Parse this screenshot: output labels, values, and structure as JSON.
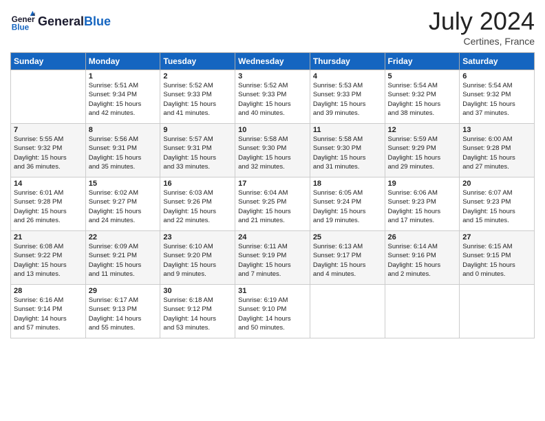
{
  "header": {
    "logo_line1": "General",
    "logo_line2": "Blue",
    "month_year": "July 2024",
    "location": "Certines, France"
  },
  "weekdays": [
    "Sunday",
    "Monday",
    "Tuesday",
    "Wednesday",
    "Thursday",
    "Friday",
    "Saturday"
  ],
  "weeks": [
    [
      {
        "day": "",
        "text": ""
      },
      {
        "day": "1",
        "text": "Sunrise: 5:51 AM\nSunset: 9:34 PM\nDaylight: 15 hours\nand 42 minutes."
      },
      {
        "day": "2",
        "text": "Sunrise: 5:52 AM\nSunset: 9:33 PM\nDaylight: 15 hours\nand 41 minutes."
      },
      {
        "day": "3",
        "text": "Sunrise: 5:52 AM\nSunset: 9:33 PM\nDaylight: 15 hours\nand 40 minutes."
      },
      {
        "day": "4",
        "text": "Sunrise: 5:53 AM\nSunset: 9:33 PM\nDaylight: 15 hours\nand 39 minutes."
      },
      {
        "day": "5",
        "text": "Sunrise: 5:54 AM\nSunset: 9:32 PM\nDaylight: 15 hours\nand 38 minutes."
      },
      {
        "day": "6",
        "text": "Sunrise: 5:54 AM\nSunset: 9:32 PM\nDaylight: 15 hours\nand 37 minutes."
      }
    ],
    [
      {
        "day": "7",
        "text": "Sunrise: 5:55 AM\nSunset: 9:32 PM\nDaylight: 15 hours\nand 36 minutes."
      },
      {
        "day": "8",
        "text": "Sunrise: 5:56 AM\nSunset: 9:31 PM\nDaylight: 15 hours\nand 35 minutes."
      },
      {
        "day": "9",
        "text": "Sunrise: 5:57 AM\nSunset: 9:31 PM\nDaylight: 15 hours\nand 33 minutes."
      },
      {
        "day": "10",
        "text": "Sunrise: 5:58 AM\nSunset: 9:30 PM\nDaylight: 15 hours\nand 32 minutes."
      },
      {
        "day": "11",
        "text": "Sunrise: 5:58 AM\nSunset: 9:30 PM\nDaylight: 15 hours\nand 31 minutes."
      },
      {
        "day": "12",
        "text": "Sunrise: 5:59 AM\nSunset: 9:29 PM\nDaylight: 15 hours\nand 29 minutes."
      },
      {
        "day": "13",
        "text": "Sunrise: 6:00 AM\nSunset: 9:28 PM\nDaylight: 15 hours\nand 27 minutes."
      }
    ],
    [
      {
        "day": "14",
        "text": "Sunrise: 6:01 AM\nSunset: 9:28 PM\nDaylight: 15 hours\nand 26 minutes."
      },
      {
        "day": "15",
        "text": "Sunrise: 6:02 AM\nSunset: 9:27 PM\nDaylight: 15 hours\nand 24 minutes."
      },
      {
        "day": "16",
        "text": "Sunrise: 6:03 AM\nSunset: 9:26 PM\nDaylight: 15 hours\nand 22 minutes."
      },
      {
        "day": "17",
        "text": "Sunrise: 6:04 AM\nSunset: 9:25 PM\nDaylight: 15 hours\nand 21 minutes."
      },
      {
        "day": "18",
        "text": "Sunrise: 6:05 AM\nSunset: 9:24 PM\nDaylight: 15 hours\nand 19 minutes."
      },
      {
        "day": "19",
        "text": "Sunrise: 6:06 AM\nSunset: 9:23 PM\nDaylight: 15 hours\nand 17 minutes."
      },
      {
        "day": "20",
        "text": "Sunrise: 6:07 AM\nSunset: 9:23 PM\nDaylight: 15 hours\nand 15 minutes."
      }
    ],
    [
      {
        "day": "21",
        "text": "Sunrise: 6:08 AM\nSunset: 9:22 PM\nDaylight: 15 hours\nand 13 minutes."
      },
      {
        "day": "22",
        "text": "Sunrise: 6:09 AM\nSunset: 9:21 PM\nDaylight: 15 hours\nand 11 minutes."
      },
      {
        "day": "23",
        "text": "Sunrise: 6:10 AM\nSunset: 9:20 PM\nDaylight: 15 hours\nand 9 minutes."
      },
      {
        "day": "24",
        "text": "Sunrise: 6:11 AM\nSunset: 9:19 PM\nDaylight: 15 hours\nand 7 minutes."
      },
      {
        "day": "25",
        "text": "Sunrise: 6:13 AM\nSunset: 9:17 PM\nDaylight: 15 hours\nand 4 minutes."
      },
      {
        "day": "26",
        "text": "Sunrise: 6:14 AM\nSunset: 9:16 PM\nDaylight: 15 hours\nand 2 minutes."
      },
      {
        "day": "27",
        "text": "Sunrise: 6:15 AM\nSunset: 9:15 PM\nDaylight: 15 hours\nand 0 minutes."
      }
    ],
    [
      {
        "day": "28",
        "text": "Sunrise: 6:16 AM\nSunset: 9:14 PM\nDaylight: 14 hours\nand 57 minutes."
      },
      {
        "day": "29",
        "text": "Sunrise: 6:17 AM\nSunset: 9:13 PM\nDaylight: 14 hours\nand 55 minutes."
      },
      {
        "day": "30",
        "text": "Sunrise: 6:18 AM\nSunset: 9:12 PM\nDaylight: 14 hours\nand 53 minutes."
      },
      {
        "day": "31",
        "text": "Sunrise: 6:19 AM\nSunset: 9:10 PM\nDaylight: 14 hours\nand 50 minutes."
      },
      {
        "day": "",
        "text": ""
      },
      {
        "day": "",
        "text": ""
      },
      {
        "day": "",
        "text": ""
      }
    ]
  ]
}
